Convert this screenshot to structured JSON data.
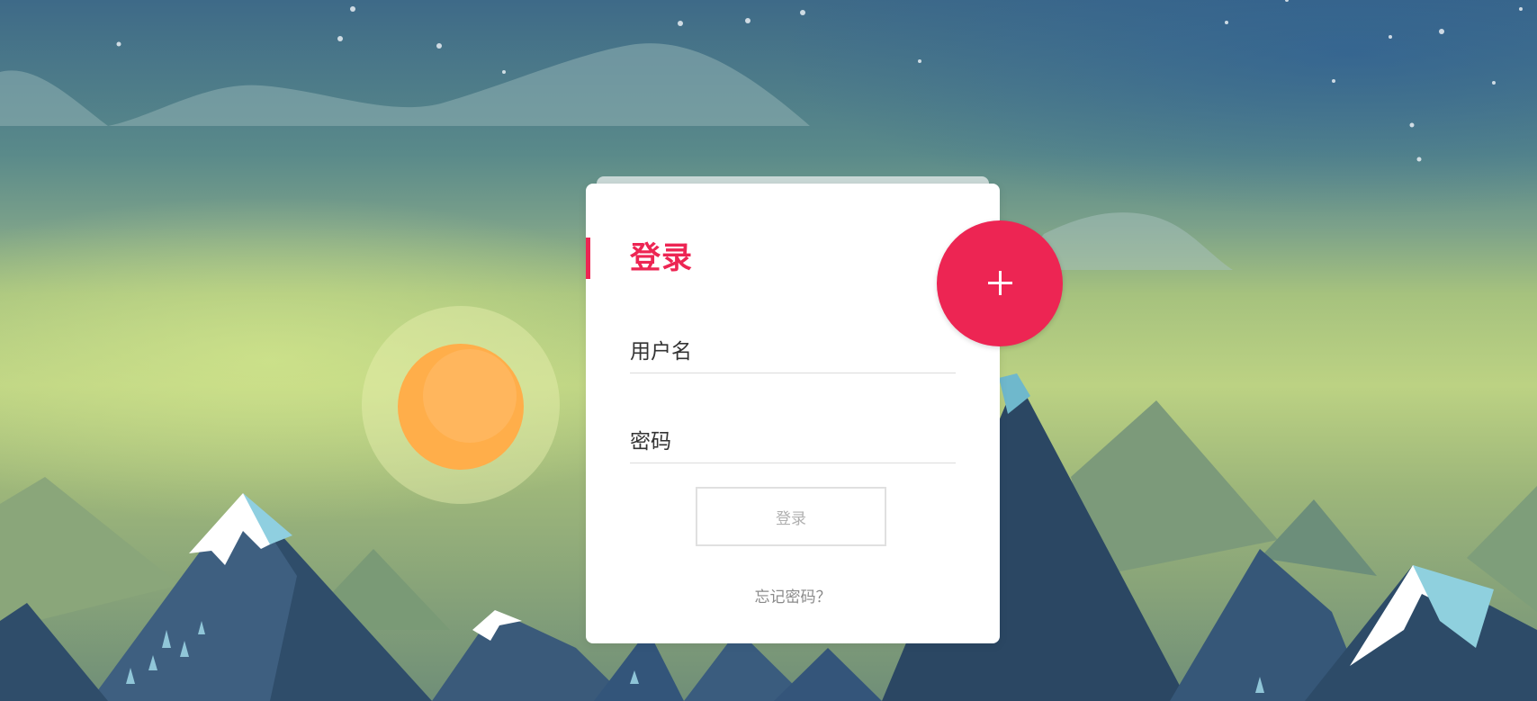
{
  "login_card": {
    "title": "登录",
    "username_placeholder": "用户名",
    "password_placeholder": "密码",
    "submit_label": "登录",
    "forgot_label": "忘记密码？"
  },
  "fab": {
    "icon": "plus-icon"
  },
  "colors": {
    "accent": "#ed2553",
    "card": "#ffffff",
    "sun": "#ffae4a"
  }
}
